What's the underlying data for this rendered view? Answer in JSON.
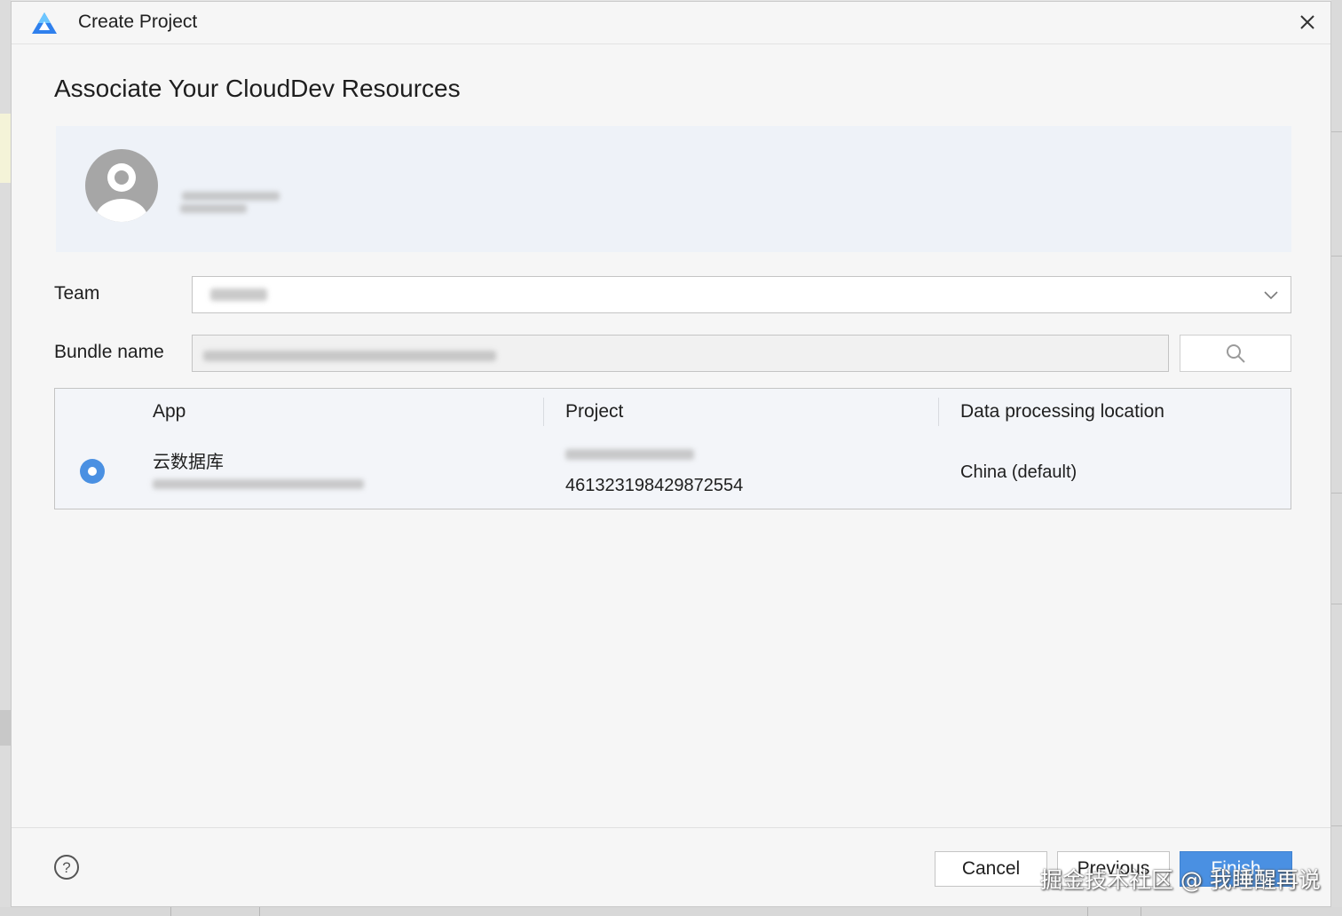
{
  "window": {
    "title": "Create Project",
    "logo_icon": "deveco-logo-icon",
    "close_icon": "close-icon"
  },
  "page": {
    "heading": "Associate Your CloudDev Resources"
  },
  "account": {
    "avatar_icon": "user-avatar-icon"
  },
  "form": {
    "team_label": "Team",
    "bundle_label": "Bundle name"
  },
  "table": {
    "headers": [
      "App",
      "Project",
      "Data processing location"
    ],
    "rows": [
      {
        "selected": true,
        "app_name": "云数据库",
        "project_id": "461323198429872554",
        "location": "China (default)"
      }
    ]
  },
  "footer": {
    "cancel_label": "Cancel",
    "previous_label": "Previous",
    "finish_label": "Finish",
    "help_icon": "help-icon"
  },
  "watermark": "掘金技术社区 @ 我睡醒再说",
  "colors": {
    "accent": "#4a90e2",
    "panel_bg": "#eef2f8",
    "dialog_bg": "#f6f6f6"
  }
}
